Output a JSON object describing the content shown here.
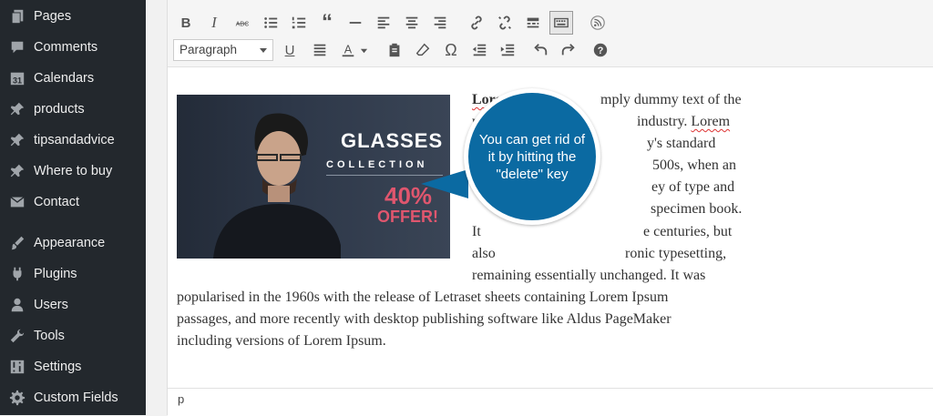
{
  "sidebar": {
    "items": [
      {
        "label": "Pages",
        "icon": "pages-icon"
      },
      {
        "label": "Comments",
        "icon": "comments-icon"
      },
      {
        "label": "Calendars",
        "icon": "calendar-icon",
        "icon_text": "31"
      },
      {
        "label": "products",
        "icon": "pin-icon"
      },
      {
        "label": "tipsandadvice",
        "icon": "pin-icon"
      },
      {
        "label": "Where to buy",
        "icon": "pin-icon"
      },
      {
        "label": "Contact",
        "icon": "mail-icon"
      },
      {
        "label": "Appearance",
        "icon": "brush-icon"
      },
      {
        "label": "Plugins",
        "icon": "plug-icon"
      },
      {
        "label": "Users",
        "icon": "user-icon"
      },
      {
        "label": "Tools",
        "icon": "wrench-icon"
      },
      {
        "label": "Settings",
        "icon": "settings-icon"
      },
      {
        "label": "Custom Fields",
        "icon": "gear-icon"
      }
    ]
  },
  "editor": {
    "format_select": "Paragraph",
    "ad": {
      "title": "GLASSES",
      "subtitle": "COLLECTION",
      "percent": "40%",
      "offer": "OFFER!"
    },
    "text_lines": [
      "Lorem",
      "mply dummy text of the",
      "pri",
      "industry.",
      "Lorem",
      "y's standard",
      "500s, when an",
      "ey of type and",
      "specimen book.",
      "It",
      "e centuries, but",
      "also",
      "ronic typesetting,",
      "remaining essentially unchanged. It was",
      "popularised in the 1960s with the release of Letraset sheets containing Lorem Ipsum",
      "passages, and more recently with desktop publishing software like Aldus PageMaker",
      "including versions of Lorem Ipsum."
    ],
    "callout": "You can get rid of it by hitting the \"delete\" key",
    "path": "p"
  }
}
